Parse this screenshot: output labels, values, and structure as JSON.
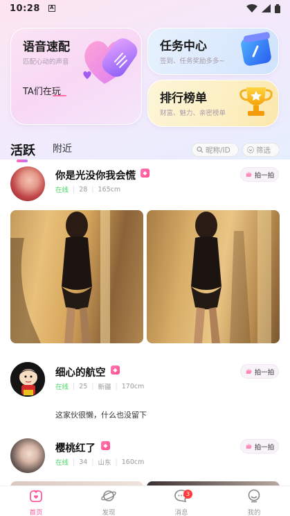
{
  "status": {
    "time": "10:28",
    "sim": "A"
  },
  "cards": {
    "voice": {
      "title": "语音速配",
      "sub": "匹配心动的声音",
      "extra": "TA们在玩"
    },
    "task": {
      "title": "任务中心",
      "sub": "签到、任务奖励多多~"
    },
    "rank": {
      "title": "排行榜单",
      "sub": "财富、魅力、亲密榜单"
    }
  },
  "tabs": {
    "active": "活跃",
    "inactive": "附近"
  },
  "search": {
    "placeholder": "昵称/ID"
  },
  "filter": {
    "label": "筛选"
  },
  "posts": [
    {
      "name": "你是光没你我会慌",
      "online": "在线",
      "age": "28",
      "height": "165cm",
      "pai": "拍一拍"
    },
    {
      "name": "细心的航空",
      "online": "在线",
      "age": "25",
      "location": "新疆",
      "height": "170cm",
      "pai": "拍一拍",
      "text": "这家伙很懒，什么也没留下"
    },
    {
      "name": "樱桃红了",
      "online": "在线",
      "age": "34",
      "location": "山东",
      "height": "160cm",
      "pai": "拍一拍"
    }
  ],
  "nav": {
    "home": "首页",
    "discover": "发现",
    "messages": "消息",
    "messages_badge": "3",
    "mine": "我的"
  },
  "colors": {
    "accent": "#ff5c9c",
    "online": "#4cd964"
  }
}
